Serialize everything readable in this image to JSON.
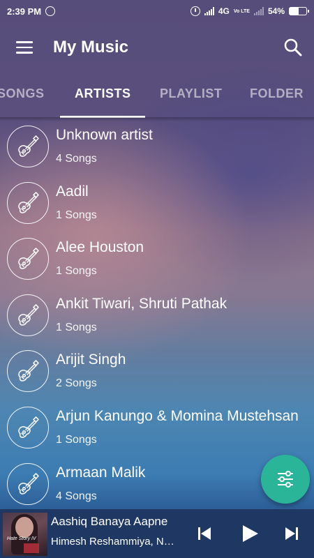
{
  "status_bar": {
    "time": "2:39 PM",
    "network": "4G",
    "volte": "Vo LTE",
    "battery": "54%",
    "battery_level": 0.54
  },
  "app_bar": {
    "title": "My Music",
    "menu_icon": "hamburger-menu-icon",
    "search_icon": "search-icon"
  },
  "tabs": [
    {
      "label": "SONGS",
      "active": false
    },
    {
      "label": "ARTISTS",
      "active": true
    },
    {
      "label": "PLAYLIST",
      "active": false
    },
    {
      "label": "FOLDER",
      "active": false
    }
  ],
  "artists": [
    {
      "name": "Unknown artist",
      "count": "4 Songs",
      "icon": "guitar-icon"
    },
    {
      "name": "Aadil",
      "count": "1 Songs",
      "icon": "guitar-icon"
    },
    {
      "name": "Alee Houston",
      "count": "1 Songs",
      "icon": "guitar-icon"
    },
    {
      "name": "Ankit Tiwari, Shruti Pathak",
      "count": "1 Songs",
      "icon": "guitar-icon"
    },
    {
      "name": "Arijit Singh",
      "count": "2 Songs",
      "icon": "guitar-icon"
    },
    {
      "name": "Arjun Kanungo & Momina Mustehsan",
      "count": "1 Songs",
      "icon": "guitar-icon"
    },
    {
      "name": "Armaan Malik",
      "count": "4 Songs",
      "icon": "guitar-icon"
    }
  ],
  "fab": {
    "icon": "equalizer-icon",
    "color": "#2bb598"
  },
  "now_playing": {
    "title": "Aashiq Banaya Aapne",
    "artist": "Himesh Reshammiya, Neha Bhasin",
    "album_caption": "Hate Story IV",
    "controls": [
      "previous-icon",
      "play-icon",
      "next-icon"
    ],
    "background": "#1f3763"
  }
}
